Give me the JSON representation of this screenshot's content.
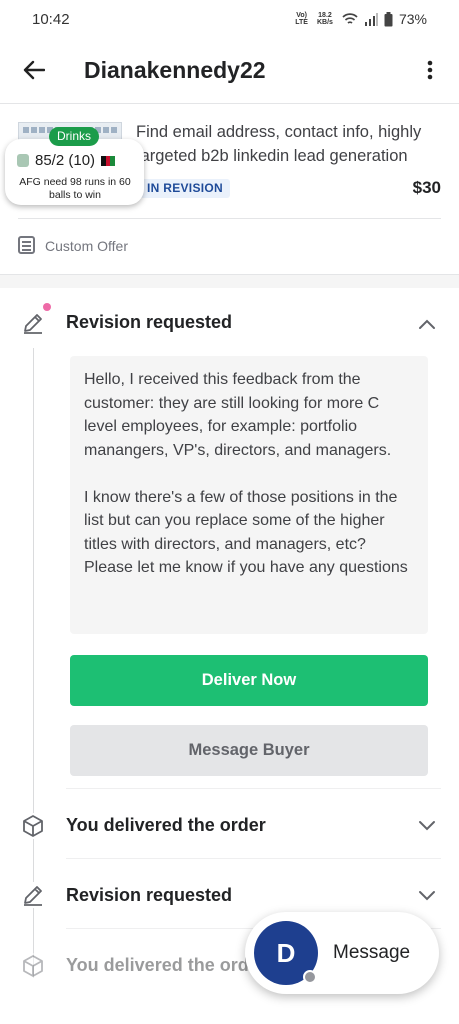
{
  "status_bar": {
    "time": "10:42",
    "network": "Vo)) LTE",
    "speed": "18.2 KB/s",
    "battery": "73%"
  },
  "header": {
    "title": "Dianakennedy22"
  },
  "gig": {
    "title": "Find email address, contact info, highly targeted b2b linkedin lead generation",
    "status": "IN REVISION",
    "price": "$30"
  },
  "score_widget": {
    "badge": "Drinks",
    "score": "85/2 (10)",
    "subtitle": "AFG need 98 runs in 60 balls to win"
  },
  "offer": {
    "label": "Custom Offer"
  },
  "timeline": {
    "items": [
      {
        "title": "Revision requested",
        "expanded": true
      },
      {
        "title": "You delivered the order",
        "expanded": false
      },
      {
        "title": "Revision requested",
        "expanded": false
      },
      {
        "title": "You delivered the order",
        "expanded": false
      }
    ],
    "message": "Hello, I received this feedback from the customer: they are still looking for more C level employees, for example: portfolio manangers, VP's, directors, and managers.\n\nI know there's a few of those positions in the list but can you replace some of the higher titles with directors, and managers, etc?\nPlease let me know if you have any questions"
  },
  "actions": {
    "deliver": "Deliver Now",
    "message_buyer": "Message Buyer"
  },
  "fab": {
    "avatar_letter": "D",
    "label": "Message"
  },
  "colors": {
    "primary_green": "#1dbf73",
    "avatar_blue": "#1e3f8f",
    "revision_badge_text": "#1f4b99",
    "notification_dot": "#ee6aa7"
  }
}
